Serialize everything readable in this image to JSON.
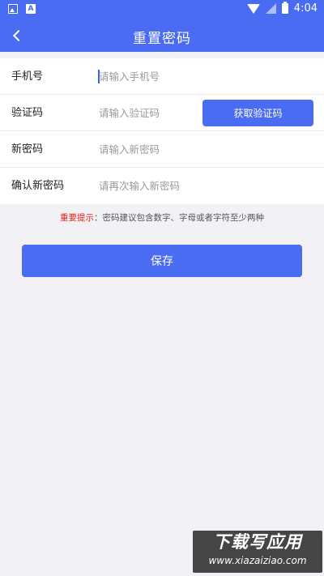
{
  "status_bar": {
    "time": "4:04",
    "left_icons": [
      "image-icon",
      "a-letter-icon"
    ],
    "right_icons": [
      "wifi-icon",
      "no-signal-icon",
      "battery-icon"
    ],
    "a_glyph": "A"
  },
  "nav": {
    "title": "重置密码",
    "back_icon": "chevron-left-icon"
  },
  "form": {
    "phone": {
      "label": "手机号",
      "placeholder": "请输入手机号",
      "value": ""
    },
    "code": {
      "label": "验证码",
      "placeholder": "请输入验证码",
      "value": "",
      "button_label": "获取验证码"
    },
    "new_password": {
      "label": "新密码",
      "placeholder": "请输入新密码",
      "value": ""
    },
    "confirm_password": {
      "label": "确认新密码",
      "placeholder": "请再次输入新密码",
      "value": ""
    }
  },
  "tip": {
    "strong": "重要提示",
    "text": "：密码建议包含数字、字母或者字符至少两种"
  },
  "save_button_label": "保存",
  "watermark": {
    "title": "下载写应用",
    "url": "www.xiazaiziao.com"
  },
  "colors": {
    "primary": "#4a6cf3",
    "background": "#f2f1f6",
    "tip_highlight": "#e0221b"
  }
}
